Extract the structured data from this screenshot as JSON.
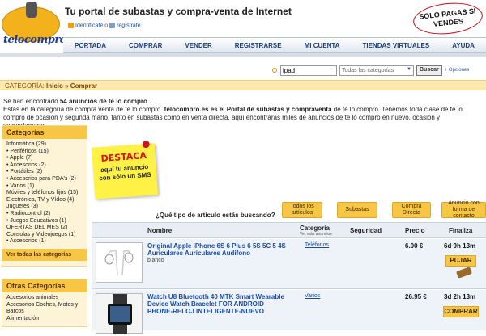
{
  "site": {
    "logo": "telocompro.es",
    "headline": "Tu portal de subastas y compra-venta de Internet",
    "stamp": "SOLO PAGAS SI VENDES"
  },
  "auth": {
    "login": "Identifícate",
    "or": "o",
    "register": "regístrate."
  },
  "nav": [
    "PORTADA",
    "COMPRAR",
    "VENDER",
    "REGISTRARSE",
    "MI CUENTA",
    "TIENDAS VIRTUALES",
    "AYUDA"
  ],
  "search": {
    "value": "ipad",
    "category": "Todas las categorías",
    "button": "Buscar",
    "options": "+ Opciones"
  },
  "breadcrumb": {
    "label": "CATEGORÍA:",
    "home": "Inicio",
    "sep": "»",
    "current": "Comprar"
  },
  "intro": {
    "line1_pre": "Se han encontrado",
    "line1_count": "54 anuncios de te lo compro",
    "line1_post": ".",
    "line2_pre": "Estás en la categoría de compra venta de te lo compro.",
    "line2_bold": "telocompro.es es el Portal de subastas y compraventa",
    "line2_post": "de te lo compro. Tenemos toda clase de te lo compro de ocasión y segunda mano, tanto en subastas como en venta directa, aquí encontrarás miles de anuncios de te lo compro en nuevo, ocasión y segundamano."
  },
  "sidebar": {
    "categories_title": "Categorías",
    "categories": [
      "Informática (29)",
      "• Periféricos (15)",
      "• Apple (7)",
      "• Accesorios (2)",
      "• Portátiles (2)",
      "• Accesorios para PDA's (2)",
      "• Varios (1)",
      "Móviles y teléfonos fijos (15)",
      "Electrónica, TV y Vídeo (4)",
      "Juguetes (3)",
      "• Radiocontrol (2)",
      "• Juegos Educativos (1)",
      "OFERTAS DEL MES (2)",
      "Consolas y Videojuegos (1)",
      "• Accesorios (1)"
    ],
    "see_all": "Ver todas las categorías",
    "other_title": "Otras Categorías",
    "other": [
      "Accesorios animales",
      "Accesorios Coches, Motos y Barcos",
      "Alimentación"
    ]
  },
  "note": {
    "title": "DESTACA",
    "line1": "aquí tu anuncio",
    "line2": "con sólo un SMS"
  },
  "type_question": "¿Qué tipo de artículo estás buscando?",
  "type_buttons": [
    "Todos los artículos",
    "Subastas",
    "Compra Directa",
    "Anuncio con forma de contacto"
  ],
  "table": {
    "headers": {
      "name": "Nombre",
      "category": "Categoría",
      "category_sub": "Ver más anuncios",
      "security": "Seguridad",
      "price": "Precio",
      "end": "Finaliza"
    },
    "rows": [
      {
        "title": "Original Apple iPhone 6S 6 Plus 6 5S 5C 5 4S Auriculares Auriculares Audifono",
        "sub": "blanco",
        "category": "Teléfonos",
        "price": "6.00 €",
        "time": "6d 9h 13m",
        "action": "PUJAR"
      },
      {
        "title": "Watch U8 Bluetooth 40 MTK Smart Wearable Device Watch Bracelet FOR ANDROID PHONE-RELOJ INTELIGENTE-NUEVO",
        "sub": "",
        "category": "Varios",
        "price": "26.95 €",
        "time": "3d 2h 13m",
        "action": "COMPRAR"
      }
    ]
  },
  "colors": {
    "accent": "#f7c645",
    "link": "#1a4b9b",
    "crumb_bg": "#fde9b0",
    "row_bg": "#eef3fa"
  }
}
